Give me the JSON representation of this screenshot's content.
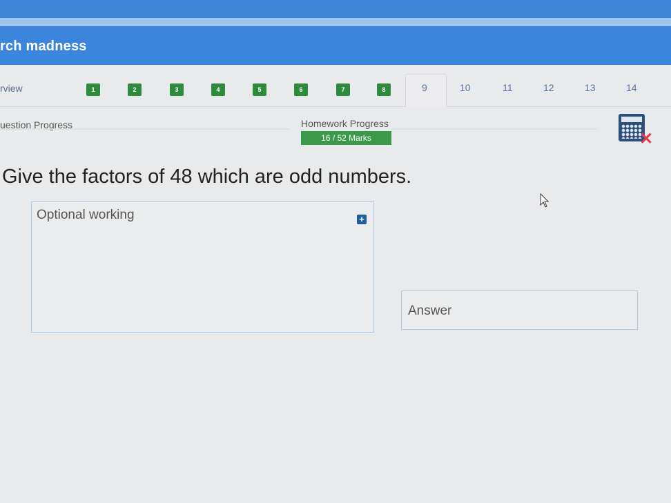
{
  "header": {
    "title": "rch madness"
  },
  "nav": {
    "overview_label": "rview",
    "questions": [
      {
        "label": "1",
        "done": true
      },
      {
        "label": "2",
        "done": true
      },
      {
        "label": "3",
        "done": true
      },
      {
        "label": "4",
        "done": true
      },
      {
        "label": "5",
        "done": true
      },
      {
        "label": "6",
        "done": true
      },
      {
        "label": "7",
        "done": true
      },
      {
        "label": "8",
        "done": true
      },
      {
        "label": "9",
        "done": false,
        "active": true
      },
      {
        "label": "10",
        "done": false
      },
      {
        "label": "11",
        "done": false
      },
      {
        "label": "12",
        "done": false
      },
      {
        "label": "13",
        "done": false
      },
      {
        "label": "14",
        "done": false
      }
    ]
  },
  "progress": {
    "question_label": "uestion Progress",
    "homework_label": "Homework Progress",
    "homework_marks": "16 / 52 Marks"
  },
  "question": {
    "text": "Give the factors of 48 which are odd numbers."
  },
  "working": {
    "placeholder": "Optional working"
  },
  "answer": {
    "placeholder": "Answer"
  },
  "icons": {
    "calculator": "calculator-icon",
    "calculator_disabled": "cross-icon",
    "add": "plus-icon"
  },
  "colors": {
    "header_blue": "#3b85dc",
    "complete_green": "#2e8b3e",
    "marks_green": "#3a9a4a",
    "disabled_red": "#e03c4b"
  }
}
